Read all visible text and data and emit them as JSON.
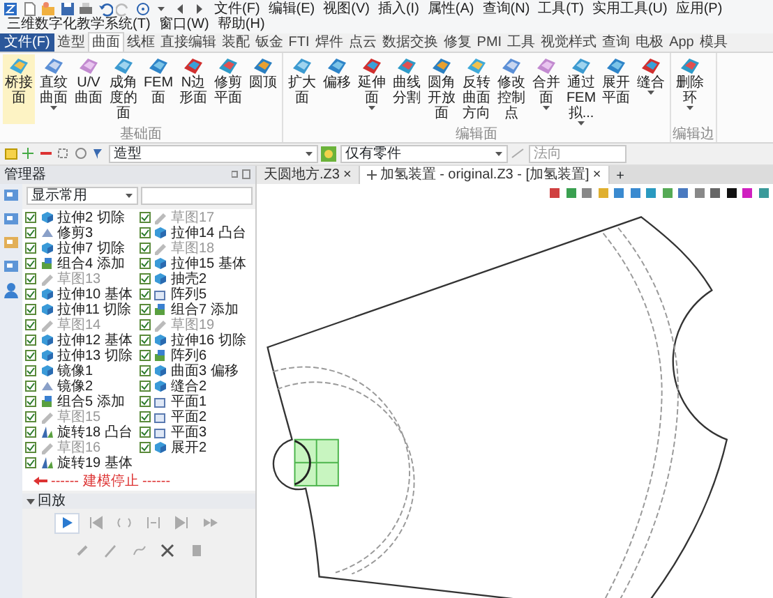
{
  "menu": [
    "文件(F)",
    "编辑(E)",
    "视图(V)",
    "插入(I)",
    "属性(A)",
    "查询(N)",
    "工具(T)",
    "实用工具(U)",
    "应用(P)",
    "三维数字化教学系统(T)",
    "窗口(W)",
    "帮助(H)"
  ],
  "file_tab": "文件(F)",
  "tabs": [
    {
      "label": "造型",
      "selected": false
    },
    {
      "label": "曲面",
      "selected": true
    },
    {
      "label": "线框",
      "selected": false
    },
    {
      "label": "直接编辑",
      "selected": false
    },
    {
      "label": "装配",
      "selected": false
    },
    {
      "label": "钣金",
      "selected": false
    },
    {
      "label": "FTI",
      "selected": false
    },
    {
      "label": "焊件",
      "selected": false
    },
    {
      "label": "点云",
      "selected": false
    },
    {
      "label": "数据交换",
      "selected": false
    },
    {
      "label": "修复",
      "selected": false
    },
    {
      "label": "PMI",
      "selected": false
    },
    {
      "label": "工具",
      "selected": false
    },
    {
      "label": "视觉样式",
      "selected": false
    },
    {
      "label": "查询",
      "selected": false
    },
    {
      "label": "电极",
      "selected": false
    },
    {
      "label": "App",
      "selected": false
    },
    {
      "label": "模具",
      "selected": false
    }
  ],
  "ribbon_groups": [
    {
      "label": "基础面",
      "buttons": [
        {
          "label": "桥接面",
          "selected": true,
          "dropdown": false
        },
        {
          "label": "直纹曲面",
          "selected": false,
          "dropdown": true
        },
        {
          "label": "U/V曲面",
          "selected": false,
          "dropdown": false
        },
        {
          "label": "成角度的面",
          "selected": false,
          "dropdown": false
        },
        {
          "label": "FEM面",
          "selected": false,
          "dropdown": false
        },
        {
          "label": "N边形面",
          "selected": false,
          "dropdown": false
        },
        {
          "label": "修剪平面",
          "selected": false,
          "dropdown": false
        },
        {
          "label": "圆顶",
          "selected": false,
          "dropdown": false
        }
      ]
    },
    {
      "label": "编辑面",
      "buttons": [
        {
          "label": "扩大面",
          "selected": false,
          "dropdown": false
        },
        {
          "label": "偏移",
          "selected": false,
          "dropdown": false
        },
        {
          "label": "延伸面",
          "selected": false,
          "dropdown": true
        },
        {
          "label": "曲线分割",
          "selected": false,
          "dropdown": false
        },
        {
          "label": "圆角开放面",
          "selected": false,
          "dropdown": false
        },
        {
          "label": "反转曲面方向",
          "selected": false,
          "dropdown": false
        },
        {
          "label": "修改控制点",
          "selected": false,
          "dropdown": false
        },
        {
          "label": "合并面",
          "selected": false,
          "dropdown": true
        },
        {
          "label": "通过FEM拟...",
          "selected": false,
          "dropdown": true
        },
        {
          "label": "展开平面",
          "selected": false,
          "dropdown": false
        },
        {
          "label": "缝合",
          "selected": false,
          "dropdown": true
        }
      ]
    },
    {
      "label": "编辑边",
      "buttons": [
        {
          "label": "删除环",
          "selected": false,
          "dropdown": true
        }
      ]
    }
  ],
  "toolbar": {
    "mode_select": "造型",
    "filter_select": "仅有零件",
    "direction_field": "法向"
  },
  "manager": {
    "title": "管理器",
    "filter": "显示常用"
  },
  "documents": [
    {
      "label": "天圆地方.Z3",
      "close": "×",
      "selected": false
    },
    {
      "label": "加氢装置 - original.Z3 - [加氢装置]",
      "close": "×",
      "selected": true
    }
  ],
  "new_tab": "+",
  "tree": [
    {
      "label": "拉伸2 切除",
      "kind": "feature",
      "checked": true
    },
    {
      "label": "修剪3",
      "kind": "trim",
      "checked": true
    },
    {
      "label": "拉伸7 切除",
      "kind": "feature",
      "checked": true
    },
    {
      "label": "组合4 添加",
      "kind": "combine",
      "checked": true
    },
    {
      "label": "草图13",
      "kind": "sketch",
      "checked": true
    },
    {
      "label": "拉伸10 基体",
      "kind": "feature",
      "checked": true
    },
    {
      "label": "拉伸11 切除",
      "kind": "feature",
      "checked": true
    },
    {
      "label": "草图14",
      "kind": "sketch",
      "checked": true
    },
    {
      "label": "拉伸12 基体",
      "kind": "feature",
      "checked": true
    },
    {
      "label": "拉伸13 切除",
      "kind": "feature",
      "checked": true
    },
    {
      "label": "镜像1",
      "kind": "feature",
      "checked": true
    },
    {
      "label": "镜像2",
      "kind": "trim",
      "checked": true
    },
    {
      "label": "组合5 添加",
      "kind": "combine",
      "checked": true
    },
    {
      "label": "草图15",
      "kind": "sketch",
      "checked": true
    },
    {
      "label": "旋转18 凸台",
      "kind": "revolve",
      "checked": true
    },
    {
      "label": "草图16",
      "kind": "sketch",
      "checked": true
    },
    {
      "label": "旋转19 基体",
      "kind": "revolve",
      "checked": true
    },
    {
      "label": "草图17",
      "kind": "sketch",
      "checked": true
    },
    {
      "label": "拉伸14 凸台",
      "kind": "feature",
      "checked": true
    },
    {
      "label": "草图18",
      "kind": "sketch",
      "checked": true
    },
    {
      "label": "拉伸15 基体",
      "kind": "feature",
      "checked": true
    },
    {
      "label": "抽壳2",
      "kind": "feature",
      "checked": true
    },
    {
      "label": "阵列5",
      "kind": "plane",
      "checked": true
    },
    {
      "label": "组合7 添加",
      "kind": "combine",
      "checked": true
    },
    {
      "label": "草图19",
      "kind": "sketch",
      "checked": true
    },
    {
      "label": "拉伸16 切除",
      "kind": "feature",
      "checked": true
    },
    {
      "label": "阵列6",
      "kind": "combine",
      "checked": true
    },
    {
      "label": "曲面3 偏移",
      "kind": "feature",
      "checked": true
    },
    {
      "label": "缝合2",
      "kind": "feature",
      "checked": true
    },
    {
      "label": "平面1",
      "kind": "plane",
      "checked": true
    },
    {
      "label": "平面2",
      "kind": "plane",
      "checked": true
    },
    {
      "label": "平面3",
      "kind": "plane",
      "checked": true
    },
    {
      "label": "展开2",
      "kind": "feature",
      "checked": true
    }
  ],
  "stop_marker": "------ 建模停止 ------",
  "playback": {
    "title": "回放"
  }
}
